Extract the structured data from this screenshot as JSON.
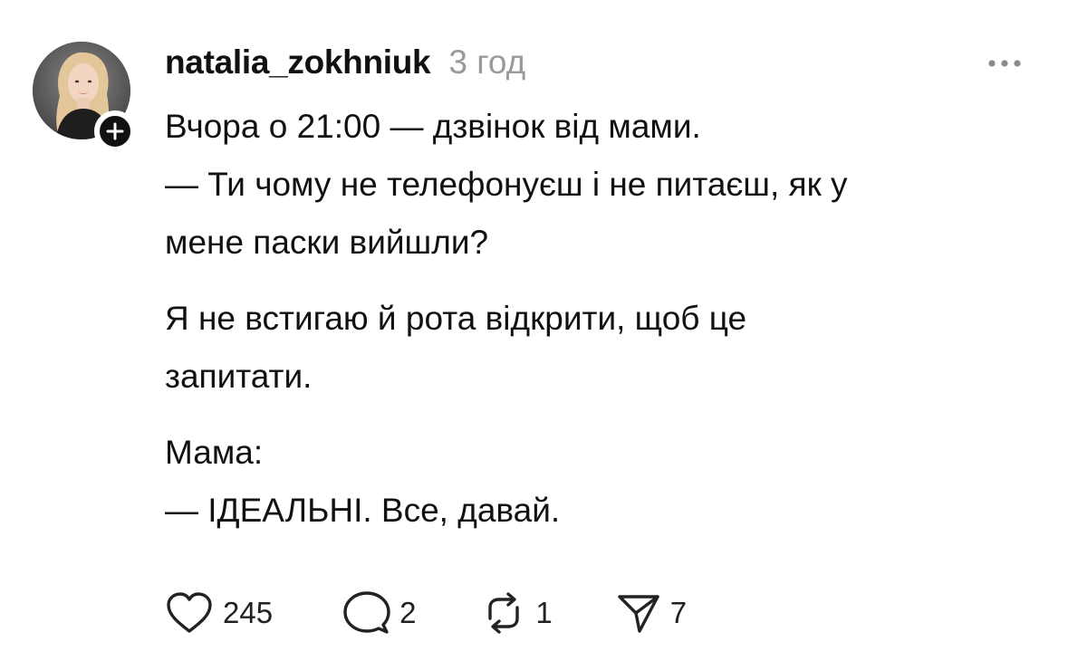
{
  "post": {
    "username": "natalia_zokhniuk",
    "time": "3 год",
    "lines": {
      "l1": "Вчора о 21:00 — дзвінок від мами.",
      "l2": "— Ти чому не телефонуєш і не питаєш, як у",
      "l3": "мене паски вийшли?",
      "l4": "Я не встигаю й рота відкрити, щоб це",
      "l5": "запитати.",
      "l6": "Мама:",
      "l7": "— ІДЕАЛЬНІ. Все, давай."
    },
    "stats": {
      "likes": "245",
      "comments": "2",
      "reposts": "1",
      "shares": "7"
    }
  },
  "icons": {
    "avatar": "avatar-photo",
    "follow": "plus-icon",
    "more": "more-dots-icon",
    "like": "heart-icon",
    "comment": "comment-bubble-icon",
    "repost": "repost-icon",
    "share": "send-icon"
  },
  "colors": {
    "text": "#111111",
    "muted": "#9a9a9a",
    "badge": "#111111"
  }
}
